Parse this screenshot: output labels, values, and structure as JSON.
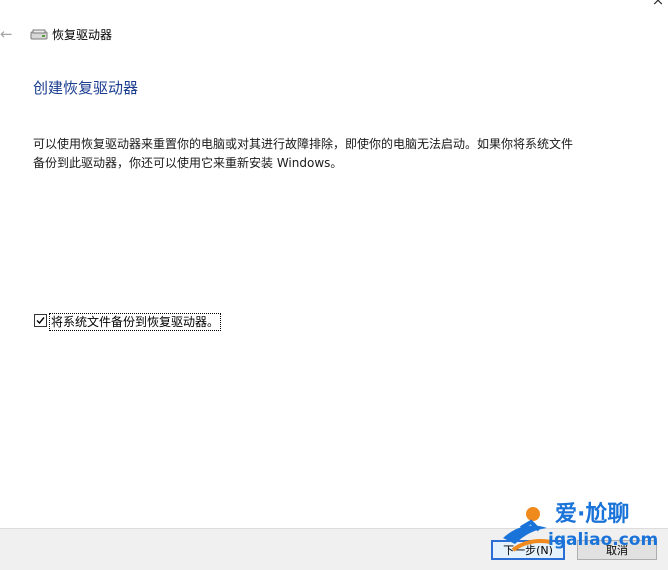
{
  "window": {
    "title": "恢复驱动器",
    "close_glyph": "×"
  },
  "nav": {
    "back_glyph": "←"
  },
  "page": {
    "title": "创建恢复驱动器",
    "description": "可以使用恢复驱动器来重置你的电脑或对其进行故障排除，即使你的电脑无法启动。如果你将系统文件备份到此驱动器，你还可以使用它来重新安装 Windows。"
  },
  "backup_option": {
    "label": "将系统文件备份到恢复驱动器。",
    "checked": true
  },
  "footer": {
    "next_label": "下一步(N)",
    "cancel_label": "取消"
  },
  "watermark": {
    "brand": "爱·尬聊",
    "url": "igaliao.com"
  },
  "icons": {
    "back": "back-arrow-icon",
    "drive": "drive-icon",
    "close": "close-icon",
    "check": "checkmark-icon"
  },
  "colors": {
    "title_blue": "#1a3d8f",
    "button_focus": "#2b6fd6",
    "watermark_blue": "#1a73d9",
    "watermark_orange": "#f08a1c"
  }
}
